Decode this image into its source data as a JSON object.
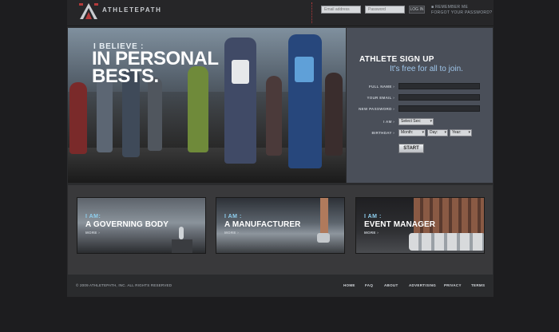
{
  "header": {
    "logo_text": "ATHLETEPATH",
    "email_placeholder": "Email address",
    "password_placeholder": "Password",
    "login_label": "LOG IN",
    "remember_label": "■ REMEMBER ME",
    "forgot_label": "FORGOT YOUR PASSWORD?"
  },
  "hero": {
    "quote_small": "I BELIEVE :",
    "quote_big_line1": "IN PERSONAL",
    "quote_big_line2": "BESTS."
  },
  "signup": {
    "title": "ATHLETE SIGN UP",
    "subtitle": "It's free for all to join.",
    "full_name_label": "FULL NAME ›",
    "email_label": "YOUR EMAIL ›",
    "password_label": "NEW PASSWORD ›",
    "i_am_label": "I AM ›",
    "sex_select": "Select Sex:",
    "birthday_label": "BIRTHDAY ›",
    "month_select": "Month:",
    "day_select": "Day:",
    "year_select": "Year:",
    "start_label": "START"
  },
  "cards": [
    {
      "iam": "I AM:",
      "name": "A GOVERNING BODY",
      "more": "MORE ›"
    },
    {
      "iam": "I AM :",
      "name": "A MANUFACTURER",
      "more": "MORE ›"
    },
    {
      "iam": "I AM :",
      "name": "EVENT MANAGER",
      "more": "MORE ›"
    }
  ],
  "footer": {
    "copyright": "© 2009 ATHLETEPATH, INC. ALL RIGHTS RESERVED",
    "links": [
      "HOME",
      "FAQ",
      "ABOUT",
      "ADVERTISING",
      "PRIVACY",
      "TERMS"
    ]
  },
  "colors": {
    "page_bg": "#1d1d1f",
    "panel_bg": "#2a2b2d",
    "signup_bg": "#4a4f59",
    "accent_blue": "#9ec4e8",
    "accent_red": "#b33a3a"
  },
  "icons": [
    "athletepath-logo-icon",
    "select-arrow-icon"
  ]
}
